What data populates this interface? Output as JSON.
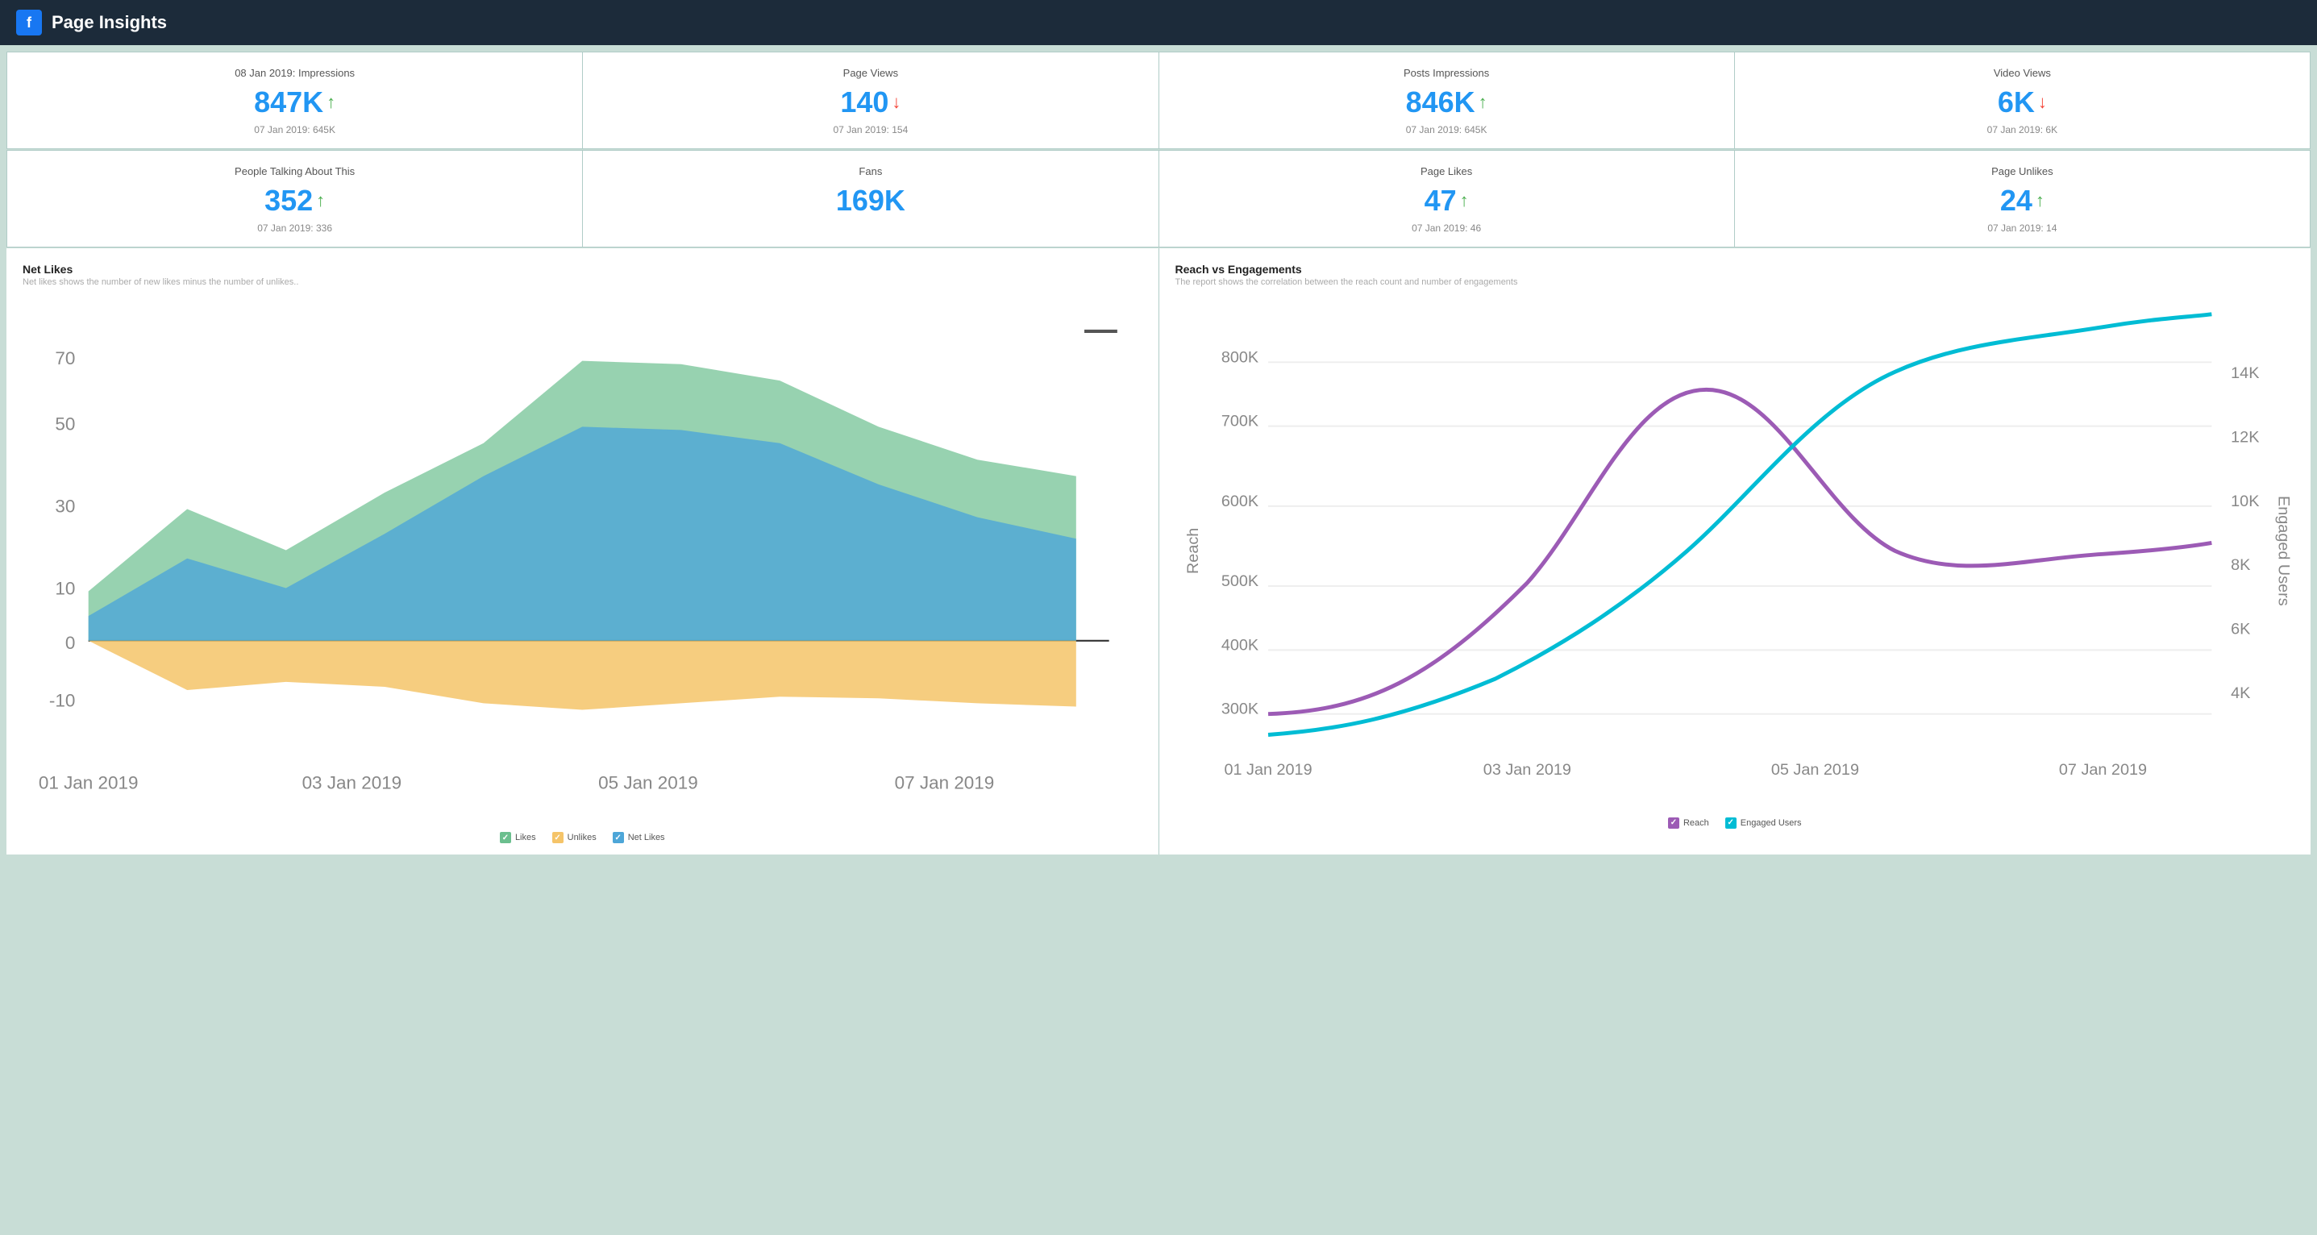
{
  "header": {
    "title": "Page Insights",
    "fb_icon": "f"
  },
  "stats_row1": [
    {
      "label": "08 Jan 2019: Impressions",
      "value": "847K",
      "trend": "up",
      "prev": "07 Jan 2019: 645K"
    },
    {
      "label": "Page Views",
      "value": "140",
      "trend": "down",
      "prev": "07 Jan 2019: 154"
    },
    {
      "label": "Posts Impressions",
      "value": "846K",
      "trend": "up",
      "prev": "07 Jan 2019: 645K"
    },
    {
      "label": "Video Views",
      "value": "6K",
      "trend": "down",
      "prev": "07 Jan 2019: 6K"
    }
  ],
  "stats_row2": [
    {
      "label": "People Talking About This",
      "value": "352",
      "trend": "up",
      "prev": "07 Jan 2019: 336"
    },
    {
      "label": "Fans",
      "value": "169K",
      "trend": "none",
      "prev": ""
    },
    {
      "label": "Page Likes",
      "value": "47",
      "trend": "up",
      "prev": "07 Jan 2019: 46"
    },
    {
      "label": "Page Unlikes",
      "value": "24",
      "trend": "up",
      "prev": "07 Jan 2019: 14"
    }
  ],
  "net_likes_chart": {
    "title": "Net Likes",
    "subtitle": "Net likes shows the number of new likes minus the number of unlikes..",
    "legend": [
      "Likes",
      "Unlikes",
      "Net Likes"
    ],
    "legend_colors": [
      "#6bbf8e",
      "#f5c469",
      "#2196f3"
    ]
  },
  "reach_chart": {
    "title": "Reach vs Engagements",
    "subtitle": "The report shows the correlation between the reach count and number of engagements",
    "legend": [
      "Reach",
      "Engaged Users"
    ],
    "legend_colors": [
      "#9c5bb5",
      "#00bcd4"
    ]
  }
}
